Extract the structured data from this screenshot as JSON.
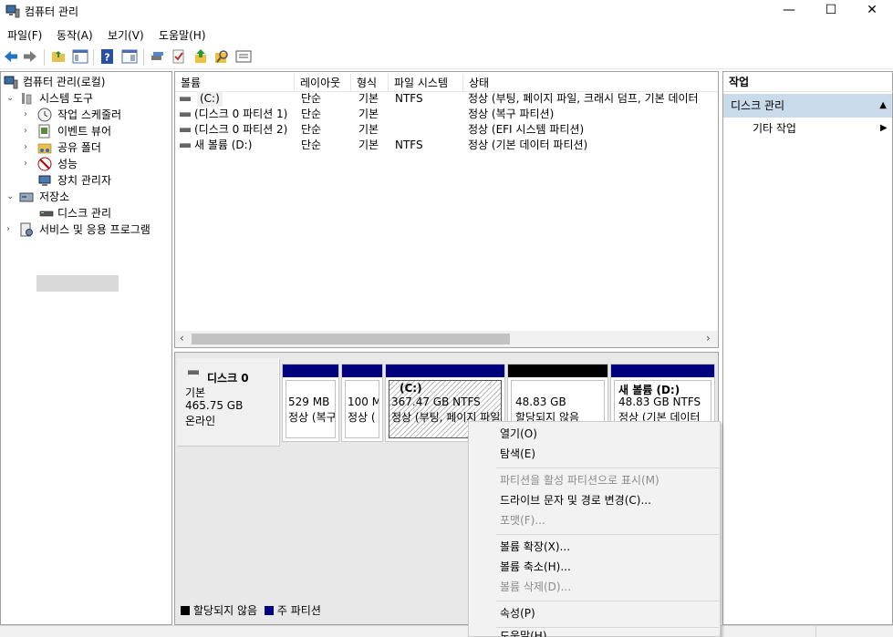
{
  "window": {
    "title": "컴퓨터 관리",
    "minimize": "—",
    "maximize": "☐",
    "close": "✕"
  },
  "menu": [
    "파일(F)",
    "동작(A)",
    "보기(V)",
    "도움말(H)"
  ],
  "toolbar_icons": [
    "back-icon",
    "forward-icon",
    "folder-up-icon",
    "show-tree-icon",
    "help-icon",
    "properties-icon",
    "connect-icon",
    "check-icon",
    "export-icon",
    "search-icon",
    "console-icon"
  ],
  "tree": {
    "root": "컴퓨터 관리(로컬)",
    "system_tools": "시스템 도구",
    "task_scheduler": "작업 스케줄러",
    "event_viewer": "이벤트 뷰어",
    "shared_folders": "공유 폴더",
    "performance": "성능",
    "device_manager": "장치 관리자",
    "storage": "저장소",
    "disk_management": "디스크 관리",
    "services": "서비스 및 응용 프로그램"
  },
  "volumes": {
    "headers": [
      "볼륨",
      "레이아웃",
      "형식",
      "파일 시스템",
      "상태"
    ],
    "rows": [
      {
        "volume": "(C:)",
        "layout": "단순",
        "type": "기본",
        "fs": "NTFS",
        "status": "정상 (부팅, 페이지 파일, 크래시 덤프, 기본 데이터"
      },
      {
        "volume": "(디스크 0 파티션 1)",
        "layout": "단순",
        "type": "기본",
        "fs": "",
        "status": "정상 (복구 파티션)"
      },
      {
        "volume": "(디스크 0 파티션 2)",
        "layout": "단순",
        "type": "기본",
        "fs": "",
        "status": "정상 (EFI 시스템 파티션)"
      },
      {
        "volume": "새 볼륨 (D:)",
        "layout": "단순",
        "type": "기본",
        "fs": "NTFS",
        "status": "정상 (기본 데이터 파티션)"
      }
    ]
  },
  "disk": {
    "name": "디스크 0",
    "type": "기본",
    "size": "465.75 GB",
    "state": "온라인",
    "partitions": [
      {
        "title": "",
        "size": "529 MB",
        "status": "정상 (복구"
      },
      {
        "title": "",
        "size": "100 M",
        "status": "정상 ("
      },
      {
        "title": "(C:)",
        "size": "367.47 GB NTFS",
        "status": "정상 (부팅, 페이지 파일"
      },
      {
        "title": "",
        "size": "48.83 GB",
        "status": "할당되지 않음"
      },
      {
        "title": "새 볼륨  (D:)",
        "size": "48.83 GB NTFS",
        "status": "정상 (기본 데이터"
      }
    ],
    "colors": {
      "primary": "#00007f",
      "unallocated": "#000000"
    }
  },
  "legend": {
    "unallocated": "할당되지 않음",
    "primary": "주 파티션"
  },
  "actions": {
    "header": "작업",
    "section": "디스크 관리",
    "more": "기타 작업"
  },
  "context_menu": {
    "open": "열기(O)",
    "explore": "탐색(E)",
    "mark_active": "파티션을 활성 파티션으로 표시(M)",
    "change_letter": "드라이브 문자 및 경로 변경(C)...",
    "format": "포맷(F)...",
    "extend": "볼륨 확장(X)...",
    "shrink": "볼륨 축소(H)...",
    "delete": "볼륨 삭제(D)...",
    "properties": "속성(P)",
    "help": "도움말(H)"
  }
}
